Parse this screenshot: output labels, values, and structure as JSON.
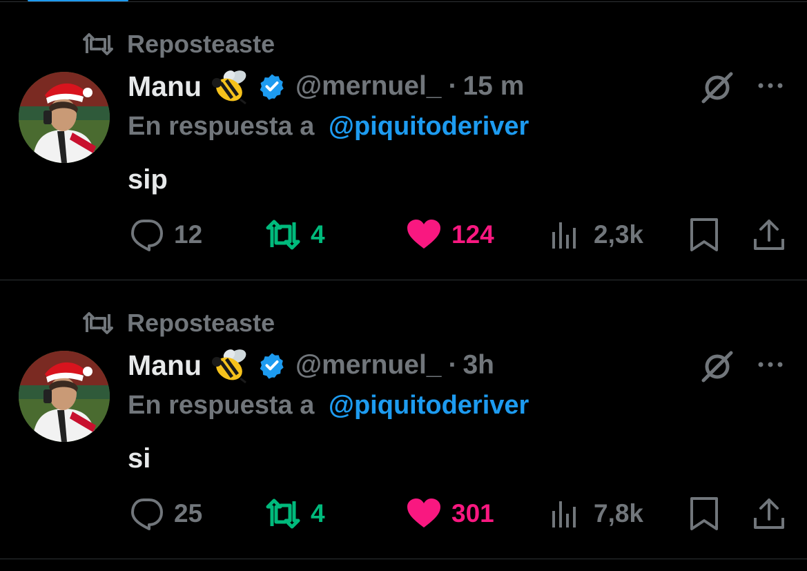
{
  "tweets": [
    {
      "repost_label": "Reposteaste",
      "display_name": "Manu",
      "handle": "@mernuel_",
      "dot": "·",
      "time": "15 m",
      "reply_prefix": "En respuesta a",
      "reply_to": "@piquitoderiver",
      "text": "sip",
      "stats": {
        "replies": "12",
        "reposts": "4",
        "likes": "124",
        "views": "2,3k"
      }
    },
    {
      "repost_label": "Reposteaste",
      "display_name": "Manu",
      "handle": "@mernuel_",
      "dot": "·",
      "time": "3h",
      "reply_prefix": "En respuesta a",
      "reply_to": "@piquitoderiver",
      "text": "si",
      "stats": {
        "replies": "25",
        "reposts": "4",
        "likes": "301",
        "views": "7,8k"
      }
    }
  ],
  "icons": {
    "repost": "repost-icon",
    "verified": "verified-badge-icon",
    "grok": "grok-icon",
    "more": "more-icon",
    "reply": "reply-icon",
    "like": "heart-icon",
    "views": "views-icon",
    "bookmark": "bookmark-icon",
    "share": "share-icon",
    "emoji": "bee-emoji"
  },
  "colors": {
    "background": "#000000",
    "text": "#e7e9ea",
    "muted": "#71767b",
    "accent": "#1d9bf0",
    "repost_green": "#00ba7c",
    "like_pink": "#f91880",
    "divider": "#2f3336"
  }
}
